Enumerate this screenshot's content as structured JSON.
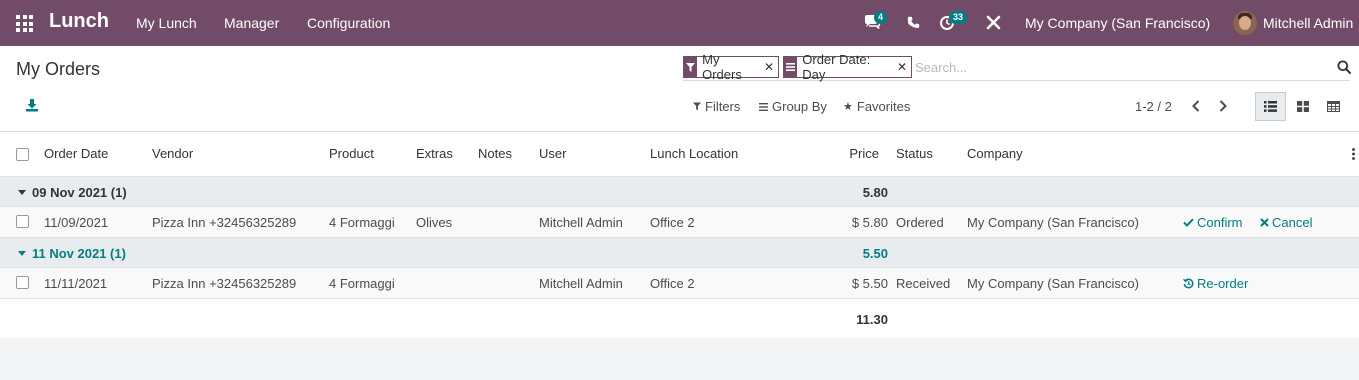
{
  "navbar": {
    "app_name": "Lunch",
    "menus": [
      "My Lunch",
      "Manager",
      "Configuration"
    ],
    "messages_count": "4",
    "activities_count": "33",
    "company": "My Company (San Francisco)",
    "user": "Mitchell Admin"
  },
  "control_panel": {
    "title": "My Orders",
    "facets": [
      {
        "icon": "filter-icon",
        "value": "My Orders"
      },
      {
        "icon": "group-by-icon",
        "value": "Order Date: Day"
      }
    ],
    "search_placeholder": "Search...",
    "filters_label": "Filters",
    "group_by_label": "Group By",
    "favorites_label": "Favorites",
    "pager": "1-2 / 2",
    "views": [
      "list-view-icon",
      "kanban-view-icon",
      "pivot-view-icon"
    ],
    "active_view": "list-view-icon"
  },
  "table": {
    "columns": {
      "order_date": "Order Date",
      "vendor": "Vendor",
      "product": "Product",
      "extras": "Extras",
      "notes": "Notes",
      "user": "User",
      "lunch_location": "Lunch Location",
      "price": "Price",
      "status": "Status",
      "company": "Company"
    },
    "groups": [
      {
        "label": "09 Nov 2021 (1)",
        "total": "5.80",
        "row": {
          "order_date": "11/09/2021",
          "vendor": "Pizza Inn +32456325289",
          "product": "4 Formaggi",
          "extras": "Olives",
          "notes": "",
          "user": "Mitchell Admin",
          "lunch_location": "Office 2",
          "price": "$ 5.80",
          "status": "Ordered",
          "company": "My Company (San Francisco)",
          "action_1": "Confirm",
          "action_2": "Cancel"
        }
      },
      {
        "label": "11 Nov 2021 (1)",
        "total": "5.50",
        "row": {
          "order_date": "11/11/2021",
          "vendor": "Pizza Inn +32456325289",
          "product": "4 Formaggi",
          "extras": "",
          "notes": "",
          "user": "Mitchell Admin",
          "lunch_location": "Office 2",
          "price": "$ 5.50",
          "status": "Received",
          "company": "My Company (San Francisco)",
          "action_1": "Re-order"
        }
      }
    ],
    "grand_total": "11.30"
  },
  "colors": {
    "brand": "#714b67",
    "accent": "#017e84"
  }
}
